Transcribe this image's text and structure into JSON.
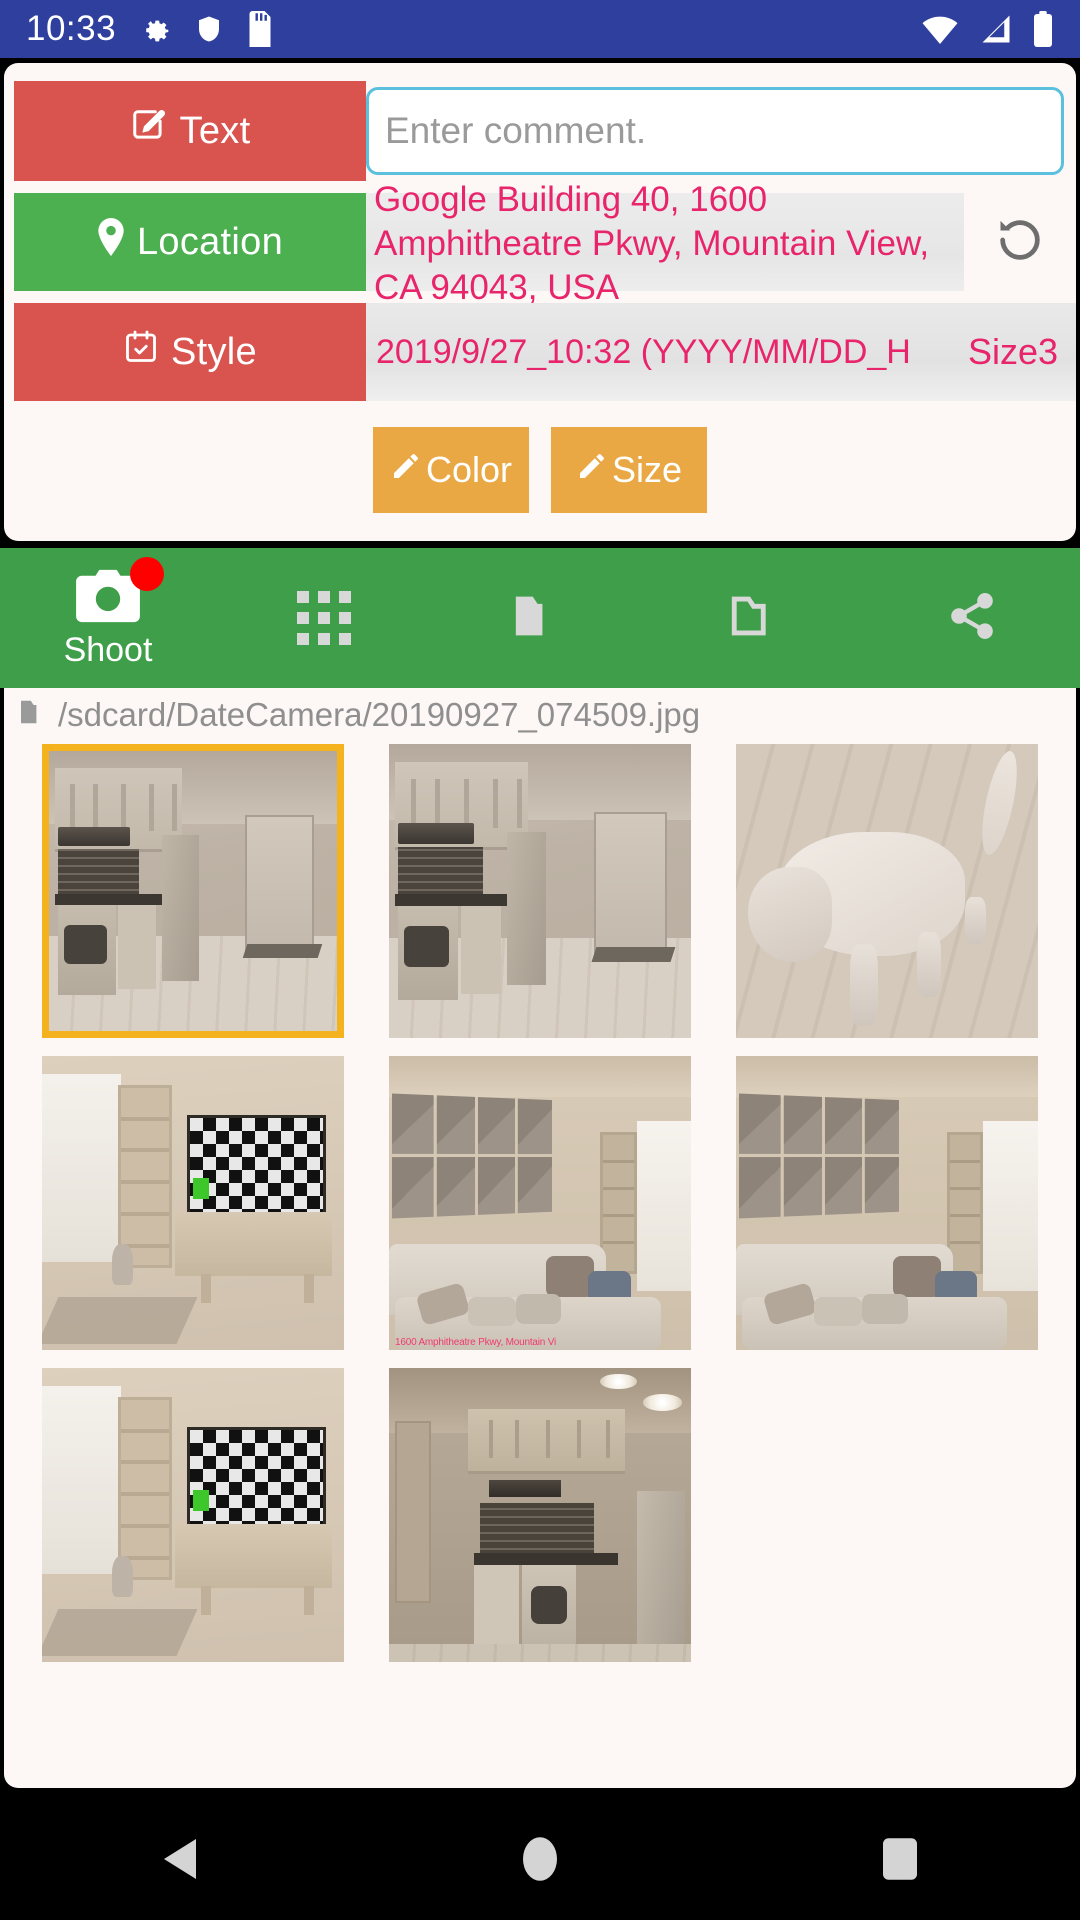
{
  "status_bar": {
    "time": "10:33",
    "left_icons": [
      "gear-icon",
      "shield-icon",
      "sdcard-icon"
    ],
    "right_icons": [
      "wifi-icon",
      "cellular-signal-icon",
      "battery-icon"
    ],
    "background_color": "#2f3f9e"
  },
  "controls": {
    "text_button": {
      "label": "Text",
      "icon": "pencil-square-icon",
      "color": "#d9534f"
    },
    "comment": {
      "value": "",
      "placeholder": "Enter comment."
    },
    "location_button": {
      "label": "Location",
      "icon": "map-pin-icon",
      "color": "#4caf50"
    },
    "location_value": "Google Building 40, 1600 Amphitheatre Pkwy, Mountain View, CA 94043, USA",
    "location_reload_icon": "reload-ccw-icon",
    "style_button": {
      "label": "Style",
      "icon": "calendar-check-icon",
      "color": "#d9534f"
    },
    "style_format": "2019/9/27_10:32 (YYYY/MM/DD_H",
    "style_size": "Size3",
    "color_button": {
      "label": "Color",
      "icon": "pencil-icon",
      "color": "#eaa844"
    },
    "size_button": {
      "label": "Size",
      "icon": "pencil-icon",
      "color": "#eaa844"
    },
    "accent_pink": "#e8246b"
  },
  "toolbar": {
    "background_color": "#3f9e49",
    "items": [
      {
        "name": "shoot",
        "label": "Shoot",
        "icon": "camera-icon",
        "badge": true
      },
      {
        "name": "grid",
        "label": "",
        "icon": "grid-icon",
        "badge": false
      },
      {
        "name": "folder-filled",
        "label": "",
        "icon": "folder-filled-icon",
        "badge": false
      },
      {
        "name": "folder-outline",
        "label": "",
        "icon": "folder-outline-icon",
        "badge": false
      },
      {
        "name": "share",
        "label": "",
        "icon": "share-icon",
        "badge": false
      }
    ]
  },
  "gallery": {
    "path_icon": "folder-icon",
    "path": "/sdcard/DateCamera/20190927_074509.jpg",
    "selection_color": "#f5b21f",
    "thumbnails": [
      {
        "scene": "kitchen",
        "selected": true,
        "stamp": ""
      },
      {
        "scene": "kitchen",
        "selected": false,
        "stamp": ""
      },
      {
        "scene": "dog",
        "selected": false,
        "stamp": ""
      },
      {
        "scene": "tvroom",
        "selected": false,
        "stamp": ""
      },
      {
        "scene": "sofaroom",
        "selected": false,
        "stamp": "1600 Amphitheatre Pkwy, Mountain Vi"
      },
      {
        "scene": "sofaroom",
        "selected": false,
        "stamp": ""
      },
      {
        "scene": "tvroom",
        "selected": false,
        "stamp": ""
      },
      {
        "scene": "kitchen2",
        "selected": false,
        "stamp": ""
      }
    ]
  },
  "navbar": {
    "back": "back-triangle-icon",
    "home": "home-circle-icon",
    "recents": "recents-square-icon"
  }
}
